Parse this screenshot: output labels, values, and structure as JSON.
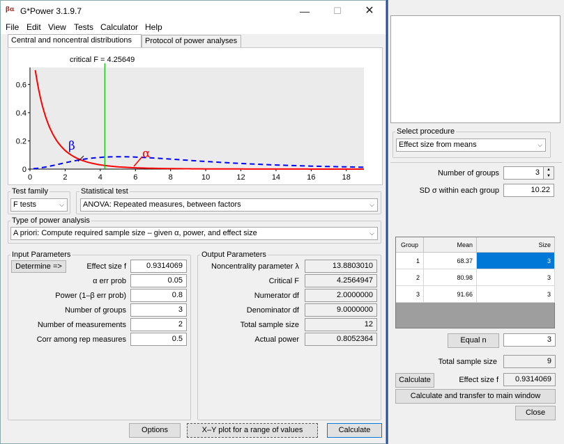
{
  "window": {
    "title": "G*Power 3.1.9.7",
    "icon_label": "βα",
    "minimize_glyph": "—",
    "maximize_glyph": "☐",
    "close_glyph": "✕"
  },
  "menu": [
    "File",
    "Edit",
    "View",
    "Tests",
    "Calculator",
    "Help"
  ],
  "tabs": [
    "Central and noncentral distributions",
    "Protocol of power analyses"
  ],
  "plot": {
    "critical_label": "critical F =  4.25649",
    "beta_label": "β",
    "alpha_label": "α",
    "x_ticks": [
      "0",
      "2",
      "4",
      "6",
      "8",
      "10",
      "12",
      "14",
      "16",
      "18"
    ],
    "y_ticks": [
      "0",
      "0.2",
      "0.4",
      "0.6"
    ],
    "x_range": [
      0,
      19
    ],
    "y_range": [
      0,
      0.72
    ],
    "critical_f": 4.25649,
    "central_color": "#ff0000",
    "noncentral_color": "#0000ff",
    "critical_color": "#00c000"
  },
  "test_family": {
    "label": "Test family",
    "value": "F tests"
  },
  "statistical_test": {
    "label": "Statistical test",
    "value": "ANOVA: Repeated measures, between factors"
  },
  "power_analysis": {
    "label": "Type of power analysis",
    "value": "A priori: Compute required sample size – given α, power, and effect size"
  },
  "input": {
    "legend": "Input Parameters",
    "determine_label": "Determine =>",
    "rows": [
      {
        "label": "Effect size f",
        "value": "0.9314069"
      },
      {
        "label": "α err prob",
        "value": "0.05"
      },
      {
        "label": "Power (1–β err prob)",
        "value": "0.8"
      },
      {
        "label": "Number of groups",
        "value": "3"
      },
      {
        "label": "Number of measurements",
        "value": "2"
      },
      {
        "label": "Corr among rep measures",
        "value": "0.5"
      }
    ]
  },
  "output": {
    "legend": "Output Parameters",
    "rows": [
      {
        "label": "Noncentrality parameter λ",
        "value": "13.8803010"
      },
      {
        "label": "Critical F",
        "value": "4.2564947"
      },
      {
        "label": "Numerator df",
        "value": "2.0000000"
      },
      {
        "label": "Denominator df",
        "value": "9.0000000"
      },
      {
        "label": "Total sample size",
        "value": "12"
      },
      {
        "label": "Actual power",
        "value": "0.8052364"
      }
    ]
  },
  "buttons": {
    "options": "Options",
    "xy_plot": "X–Y plot for a range of values",
    "calculate": "Calculate"
  },
  "effect_panel": {
    "select_procedure_label": "Select procedure",
    "procedure": "Effect size from means",
    "num_groups_label": "Number of groups",
    "num_groups": "3",
    "sd_label": "SD σ within each group",
    "sd_value": "10.22",
    "table_headers": [
      "Group",
      "Mean",
      "Size"
    ],
    "table_rows": [
      {
        "group": "1",
        "mean": "68.37",
        "size": "3"
      },
      {
        "group": "2",
        "mean": "80.98",
        "size": "3"
      },
      {
        "group": "3",
        "mean": "91.66",
        "size": "3"
      }
    ],
    "equal_n_label": "Equal n",
    "equal_n_value": "3",
    "total_sample_label": "Total sample size",
    "total_sample_value": "9",
    "calculate_label": "Calculate",
    "effect_size_label": "Effect size f",
    "effect_size_value": "0.9314069",
    "transfer_label": "Calculate and transfer to main window",
    "close_label": "Close"
  }
}
